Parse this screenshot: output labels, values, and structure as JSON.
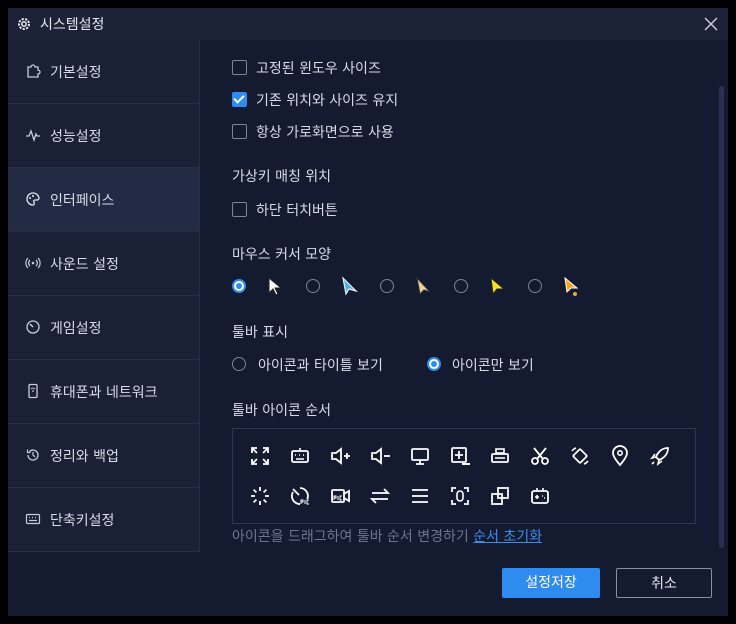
{
  "window": {
    "title": "시스템설정"
  },
  "sidebar": {
    "items": [
      {
        "label": "기본설정",
        "icon": "puzzle-icon",
        "active": false
      },
      {
        "label": "성능설정",
        "icon": "pulse-icon",
        "active": false
      },
      {
        "label": "인터페이스",
        "icon": "palette-icon",
        "active": true
      },
      {
        "label": "사운드 설정",
        "icon": "sound-icon",
        "active": false
      },
      {
        "label": "게임설정",
        "icon": "gauge-icon",
        "active": false
      },
      {
        "label": "휴대폰과 네트워크",
        "icon": "phone-icon",
        "active": false
      },
      {
        "label": "정리와 백업",
        "icon": "history-icon",
        "active": false
      },
      {
        "label": "단축키설정",
        "icon": "keyboard-icon",
        "active": false
      }
    ]
  },
  "options": {
    "fixed_window_size": {
      "label": "고정된 윈도우 사이즈",
      "checked": false
    },
    "keep_position_size": {
      "label": "기존 위치와 사이즈 유지",
      "checked": true
    },
    "always_landscape": {
      "label": "항상 가로화면으로 사용",
      "checked": false
    }
  },
  "virtual_key": {
    "title": "가상키 매칭 위치",
    "bottom_touch_button": {
      "label": "하단 터치버튼",
      "checked": false
    }
  },
  "mouse_cursor": {
    "title": "마우스 커서 모양",
    "selected_index": 0,
    "options": [
      "cursor-white-icon",
      "cursor-blue-icon",
      "cursor-beige-icon",
      "cursor-yellow-icon",
      "cursor-orange-icon"
    ]
  },
  "toolbar_display": {
    "title": "툴바 표시",
    "options": [
      {
        "label": "아이콘과 타이틀 보기",
        "selected": false
      },
      {
        "label": "아이콘만 보기",
        "selected": true
      }
    ]
  },
  "toolbar_order": {
    "title": "툴바 아이콘 순서",
    "icons_row1": [
      "fullscreen-icon",
      "keyboard-icon",
      "volume-up-icon",
      "volume-down-icon",
      "monitor-icon",
      "apk-install-icon",
      "printer-icon",
      "scissors-icon",
      "rotate-icon",
      "location-icon",
      "rocket-icon"
    ],
    "icons_row2": [
      "loading-icon",
      "record-gauge-icon",
      "record-video-icon",
      "swap-icon",
      "menu-icon",
      "screenshot-icon",
      "multi-window-icon",
      "gamepad-icon"
    ],
    "hint": "아이콘을 드래그하여 툴바 순서 변경하기",
    "reset_link": "순서 초기화"
  },
  "buttons": {
    "save": "설정저장",
    "cancel": "취소"
  },
  "colors": {
    "accent": "#2e8cf0",
    "background": "#141a30",
    "sidebar": "#1a2036"
  }
}
